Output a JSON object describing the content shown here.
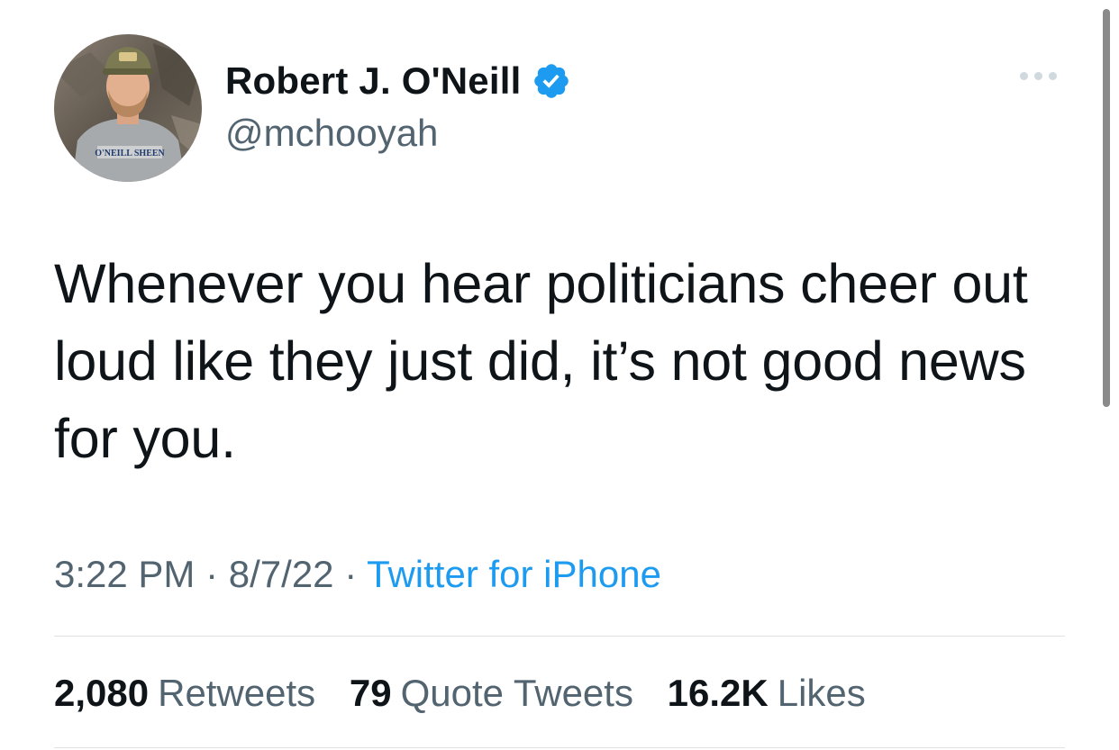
{
  "author": {
    "name": "Robert J. O'Neill",
    "handle": "@mchooyah",
    "verified_icon": "verified-badge-icon",
    "avatar": {
      "description_icon": "profile-photo",
      "shirt_text": "O'NEILL SHEEN"
    }
  },
  "tweet": {
    "text": "Whenever you hear politicians cheer out loud like they just did, it’s not good news for you.",
    "time": "3:22 PM",
    "separator": "·",
    "date": "8/7/22",
    "source": "Twitter for iPhone"
  },
  "stats": {
    "retweets_count": "2,080",
    "retweets_label": "Retweets",
    "quotes_count": "79",
    "quotes_label": "Quote Tweets",
    "likes_count": "16.2K",
    "likes_label": "Likes"
  },
  "colors": {
    "accent": "#1d9bf0",
    "text_primary": "#0f1419",
    "text_secondary": "#536471"
  }
}
